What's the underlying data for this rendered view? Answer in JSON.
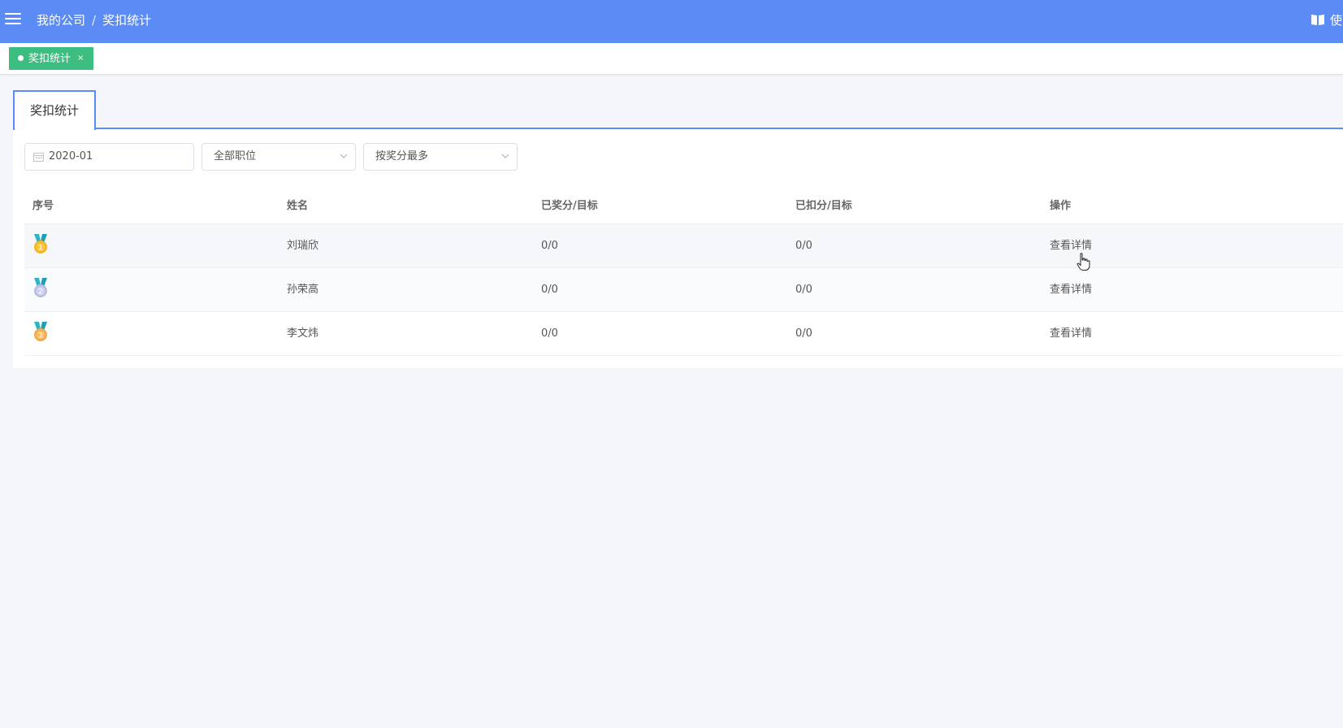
{
  "header": {
    "breadcrumb": [
      "我的公司",
      "奖扣统计"
    ],
    "breadcrumb_sep": "/",
    "right_label": "使",
    "accent_color": "#5b8cf6"
  },
  "tags": [
    {
      "label": "奖扣统计",
      "close": "×",
      "color": "#3ebd80"
    }
  ],
  "tabs": [
    {
      "label": "奖扣统计",
      "active": true
    }
  ],
  "filters": {
    "month": "2020-01",
    "position": "全部职位",
    "sort": "按奖分最多"
  },
  "table": {
    "columns": [
      "序号",
      "姓名",
      "已奖分/目标",
      "已扣分/目标",
      "操作"
    ],
    "rows": [
      {
        "rank": 1,
        "medal": "gold-medal-icon",
        "name": "刘瑞欣",
        "awarded": "0/0",
        "deducted": "0/0",
        "action": "查看详情"
      },
      {
        "rank": 2,
        "medal": "silver-medal-icon",
        "name": "孙荣高",
        "awarded": "0/0",
        "deducted": "0/0",
        "action": "查看详情"
      },
      {
        "rank": 3,
        "medal": "bronze-medal-icon",
        "name": "李文炜",
        "awarded": "0/0",
        "deducted": "0/0",
        "action": "查看详情"
      }
    ]
  }
}
